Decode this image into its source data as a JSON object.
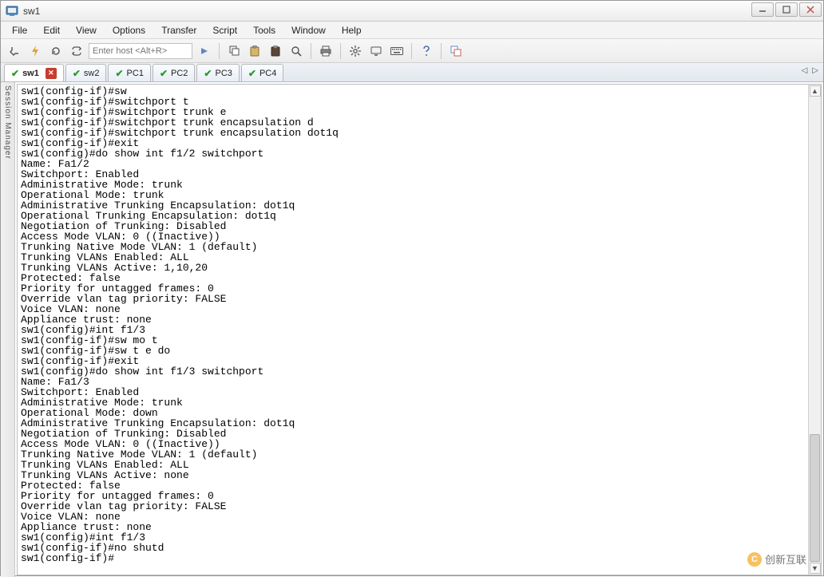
{
  "window": {
    "title": "sw1"
  },
  "menu": {
    "items": [
      "File",
      "Edit",
      "View",
      "Options",
      "Transfer",
      "Script",
      "Tools",
      "Window",
      "Help"
    ]
  },
  "toolbar": {
    "host_placeholder": "Enter host <Alt+R>",
    "icons": {
      "socket": "socket-icon",
      "lightning": "quick-connect-icon",
      "reconnect": "reconnect-icon",
      "loop": "loop-icon",
      "go": "go-icon",
      "copy": "copy-icon",
      "paste": "paste-icon",
      "clipboard": "clipboard-icon",
      "find": "find-icon",
      "print": "print-icon",
      "settings": "settings-icon",
      "display": "display-icon",
      "keyboard": "keyboard-icon",
      "help": "help-icon",
      "cascade": "window-layout-icon"
    }
  },
  "tabs": {
    "items": [
      {
        "label": "sw1",
        "active": true,
        "closeable": true
      },
      {
        "label": "sw2",
        "active": false,
        "closeable": false
      },
      {
        "label": "PC1",
        "active": false,
        "closeable": false
      },
      {
        "label": "PC2",
        "active": false,
        "closeable": false
      },
      {
        "label": "PC3",
        "active": false,
        "closeable": false
      },
      {
        "label": "PC4",
        "active": false,
        "closeable": false
      }
    ]
  },
  "session_manager_label": "Session Manager",
  "terminal_lines": [
    "sw1(config-if)#sw",
    "sw1(config-if)#switchport t",
    "sw1(config-if)#switchport trunk e",
    "sw1(config-if)#switchport trunk encapsulation d",
    "sw1(config-if)#switchport trunk encapsulation dot1q",
    "sw1(config-if)#exit",
    "sw1(config)#do show int f1/2 switchport",
    "Name: Fa1/2",
    "Switchport: Enabled",
    "Administrative Mode: trunk",
    "Operational Mode: trunk",
    "Administrative Trunking Encapsulation: dot1q",
    "Operational Trunking Encapsulation: dot1q",
    "Negotiation of Trunking: Disabled",
    "Access Mode VLAN: 0 ((Inactive))",
    "Trunking Native Mode VLAN: 1 (default)",
    "Trunking VLANs Enabled: ALL",
    "Trunking VLANs Active: 1,10,20",
    "Protected: false",
    "Priority for untagged frames: 0",
    "Override vlan tag priority: FALSE",
    "Voice VLAN: none",
    "Appliance trust: none",
    "sw1(config)#int f1/3",
    "sw1(config-if)#sw mo t",
    "sw1(config-if)#sw t e do",
    "sw1(config-if)#exit",
    "sw1(config)#do show int f1/3 switchport",
    "Name: Fa1/3",
    "Switchport: Enabled",
    "Administrative Mode: trunk",
    "Operational Mode: down",
    "Administrative Trunking Encapsulation: dot1q",
    "Negotiation of Trunking: Disabled",
    "Access Mode VLAN: 0 ((Inactive))",
    "Trunking Native Mode VLAN: 1 (default)",
    "Trunking VLANs Enabled: ALL",
    "Trunking VLANs Active: none",
    "Protected: false",
    "Priority for untagged frames: 0",
    "Override vlan tag priority: FALSE",
    "Voice VLAN: none",
    "Appliance trust: none",
    "sw1(config)#int f1/3",
    "sw1(config-if)#no shutd",
    "sw1(config-if)#"
  ],
  "watermark": {
    "text": "创新互联"
  }
}
